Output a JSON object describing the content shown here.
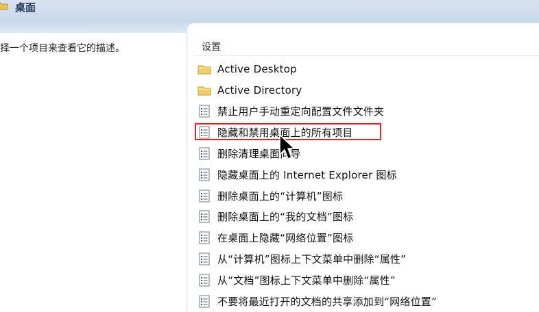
{
  "header": {
    "title": "桌面"
  },
  "left_pane": {
    "description": "择一个项目来查看它的描述。"
  },
  "list": {
    "column_header": "设置",
    "items": [
      {
        "label": "Active Desktop",
        "icon": "folder-icon"
      },
      {
        "label": "Active Directory",
        "icon": "folder-icon"
      },
      {
        "label": "禁止用户手动重定向配置文件文件夹",
        "icon": "policy-setting-icon"
      },
      {
        "label": "隐藏和禁用桌面上的所有项目",
        "icon": "policy-setting-icon",
        "selected": true
      },
      {
        "label": "删除清理桌面向导",
        "icon": "policy-setting-icon"
      },
      {
        "label": "隐藏桌面上的 Internet Explorer 图标",
        "icon": "policy-setting-icon"
      },
      {
        "label": "删除桌面上的“计算机”图标",
        "icon": "policy-setting-icon"
      },
      {
        "label": "删除桌面上的“我的文档”图标",
        "icon": "policy-setting-icon"
      },
      {
        "label": "在桌面上隐藏“网络位置”图标",
        "icon": "policy-setting-icon"
      },
      {
        "label": "从“计算机”图标上下文菜单中删除“属性”",
        "icon": "policy-setting-icon"
      },
      {
        "label": "从“文档”图标上下文菜单中删除“属性”",
        "icon": "policy-setting-icon"
      },
      {
        "label": "不要将最近打开的文档的共享添加到“网络位置”",
        "icon": "policy-setting-icon"
      }
    ]
  },
  "colors": {
    "highlight_border": "#e0242a",
    "header_bg": "#c9d8ea",
    "folder": "#e8c35a"
  }
}
